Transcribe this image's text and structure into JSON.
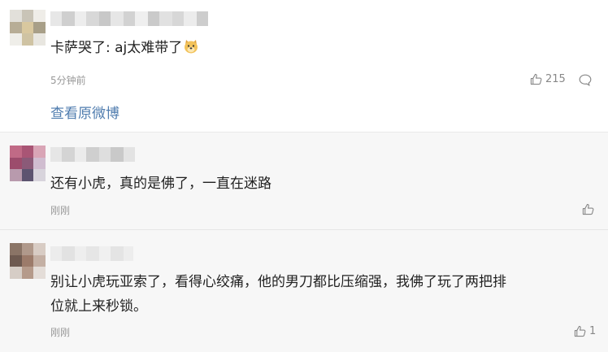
{
  "comments": [
    {
      "text": "卡萨哭了: aj太难带了",
      "emoji": "doge-emoji",
      "time": "5分钟前",
      "likes": "215",
      "link": "查看原微博",
      "avatar_colors": [
        "#e2e0da",
        "#c9c4b7",
        "#efede8",
        "#b7ad96",
        "#d9c89f",
        "#a89f88",
        "#efeee9",
        "#cfc3a3",
        "#e8e6e0"
      ]
    },
    {
      "text": "还有小虎，真的是佛了，一直在迷路",
      "time": "刚刚",
      "avatar_colors": [
        "#c06a86",
        "#a95575",
        "#d9a5b6",
        "#9c4c6c",
        "#8b5a78",
        "#d0bdd0",
        "#b89aad",
        "#5d5470",
        "#d8d4dc"
      ]
    },
    {
      "text_line1": "别让小虎玩亚索了，看得心绞痛，他的男刀都比压缩强，我佛了玩了两把排",
      "text_line2": "位就上来秒锁。",
      "time": "刚刚",
      "likes": "1",
      "avatar_colors": [
        "#8a7466",
        "#b0998b",
        "#d8ccc4",
        "#6e5a50",
        "#9c7b6a",
        "#c4b0a4",
        "#d6cdc6",
        "#b59a8a",
        "#e4ddd8"
      ]
    }
  ]
}
